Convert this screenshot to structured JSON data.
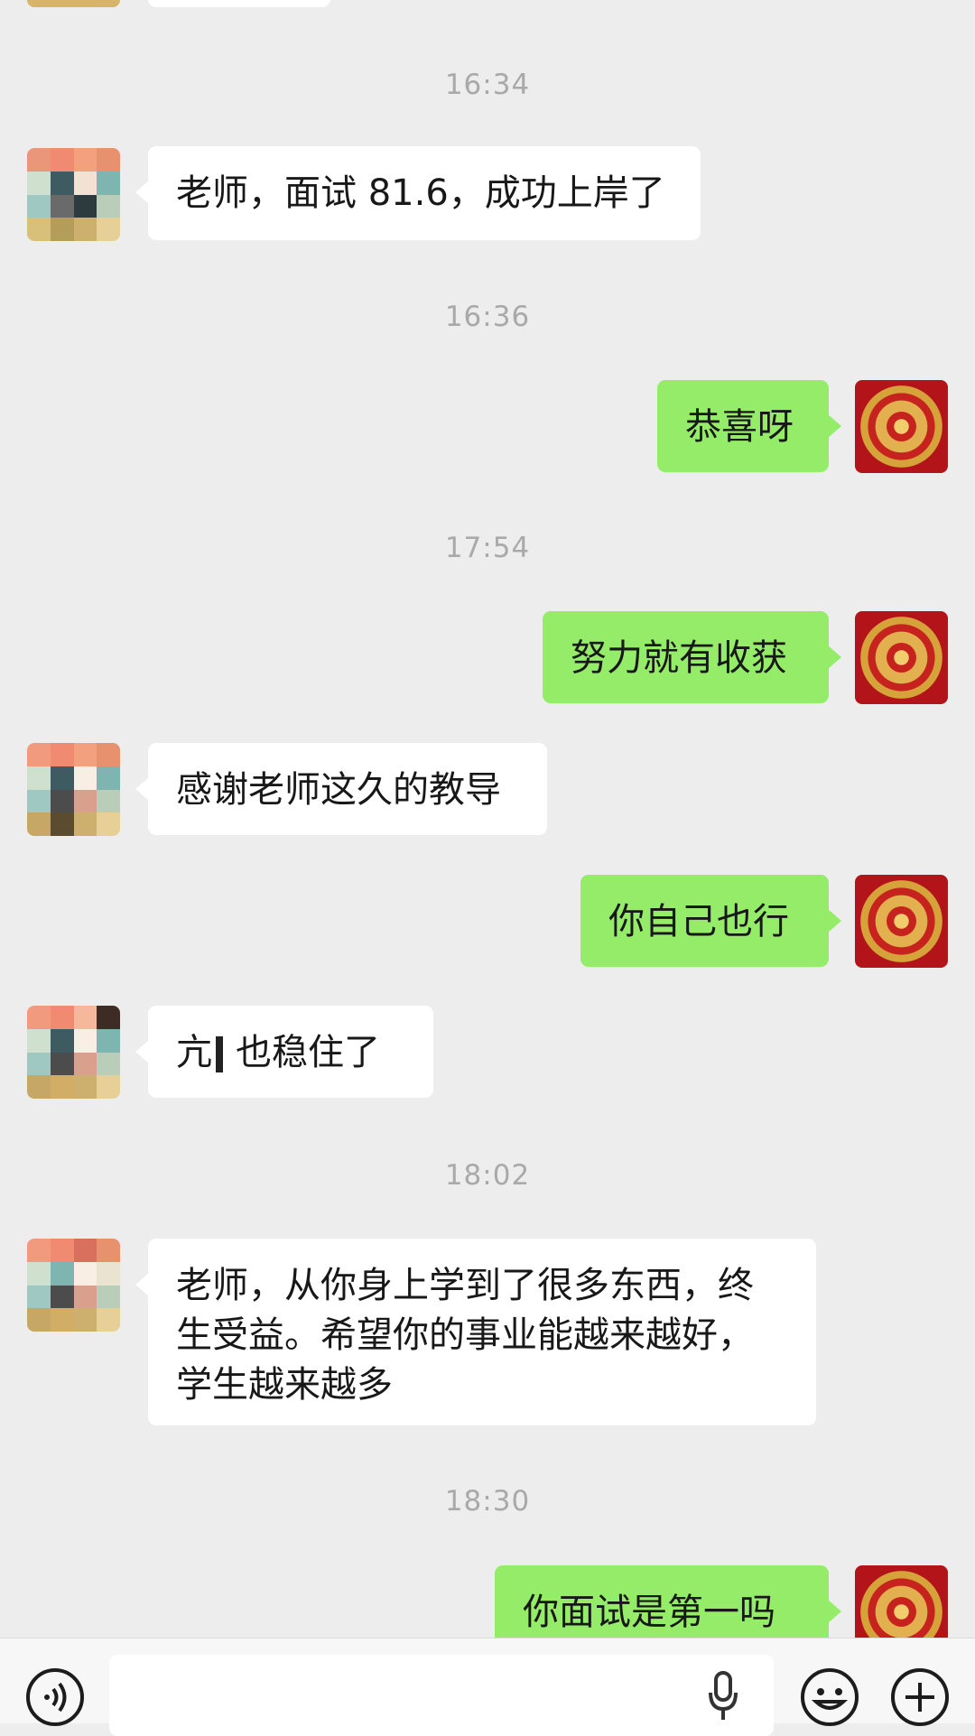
{
  "chat": {
    "messages": [
      {
        "type": "time",
        "text": "16:34"
      },
      {
        "type": "msg",
        "side": "left",
        "text": "老师，面试 81.6，成功上岸了"
      },
      {
        "type": "time",
        "text": "16:36"
      },
      {
        "type": "msg",
        "side": "right",
        "text": "恭喜呀"
      },
      {
        "type": "time",
        "text": "17:54"
      },
      {
        "type": "msg",
        "side": "right",
        "text": "努力就有收获"
      },
      {
        "type": "msg",
        "side": "left",
        "text": "感谢老师这久的教导"
      },
      {
        "type": "msg",
        "side": "right",
        "text": "你自己也行"
      },
      {
        "type": "msg",
        "side": "left",
        "text_visible_prefix": "亢",
        "text": "也稳住了"
      },
      {
        "type": "time",
        "text": "18:02"
      },
      {
        "type": "msg",
        "side": "left",
        "text": "老师，从你身上学到了很多东西，终生受益。希望你的事业能越来越好，学生越来越多"
      },
      {
        "type": "time",
        "text": "18:30"
      },
      {
        "type": "msg",
        "side": "right",
        "text": "你面试是第一吗"
      }
    ]
  },
  "input_bar": {
    "icons": [
      "voice-icon",
      "microphone-icon",
      "emoji-icon",
      "add-icon"
    ],
    "text_value": ""
  },
  "colors": {
    "background": "#ededed",
    "bubble_self": "#95ec69",
    "bubble_other": "#ffffff",
    "timestamp": "#a9a9a9"
  }
}
